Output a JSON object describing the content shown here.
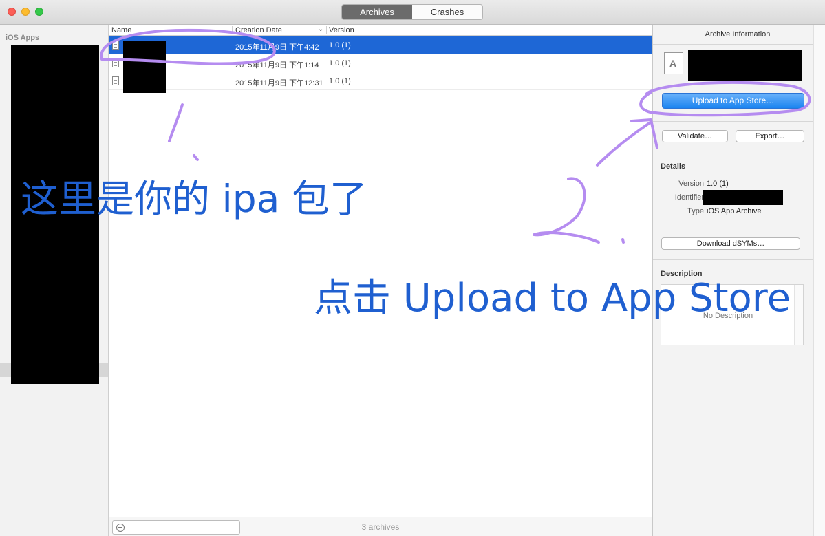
{
  "toolbar": {
    "tabs": [
      {
        "label": "Archives",
        "active": true
      },
      {
        "label": "Crashes",
        "active": false
      }
    ]
  },
  "sidebar": {
    "header": "iOS Apps"
  },
  "list": {
    "columns": [
      "Name",
      "Creation Date",
      "Version"
    ],
    "rows": [
      {
        "date": "2015年11月9日 下午4:42",
        "version": "1.0 (1)",
        "selected": true
      },
      {
        "date": "2015年11月9日 下午1:14",
        "version": "1.0 (1)",
        "selected": false
      },
      {
        "date": "2015年11月9日 下午12:31",
        "version": "1.0 (1)",
        "selected": false
      }
    ],
    "footer_count": "3 archives"
  },
  "inspector": {
    "title": "Archive Information",
    "upload_label": "Upload to App Store…",
    "validate_label": "Validate…",
    "export_label": "Export…",
    "details_heading": "Details",
    "details": [
      {
        "label": "Version",
        "value": "1.0 (1)"
      },
      {
        "label": "Identifier",
        "value": ""
      },
      {
        "label": "Type",
        "value": "iOS App Archive"
      }
    ],
    "dsyms_label": "Download dSYMs…",
    "description_heading": "Description",
    "description_placeholder": "No Description"
  },
  "annotations": {
    "note_1": "这里是你的 ipa 包了",
    "note_2": "点击 Upload to App Store",
    "color": "#1f5fd0",
    "marker_color": "#b58cf0"
  }
}
